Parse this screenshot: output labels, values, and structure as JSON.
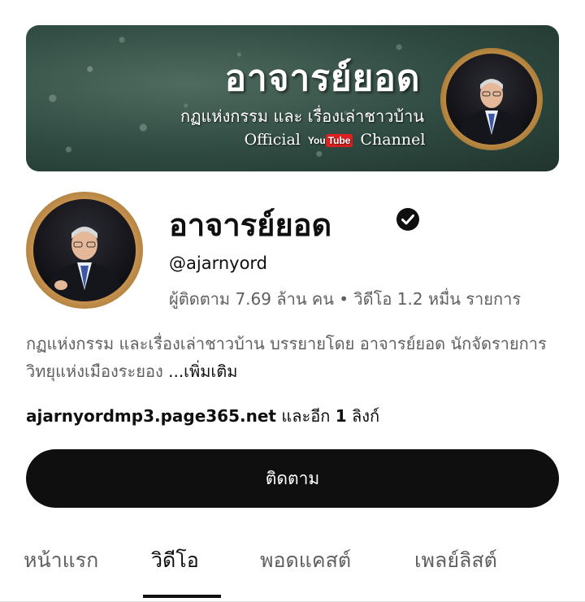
{
  "banner": {
    "title": "อาจารย์ยอด",
    "subtitle": "กฏแห่งกรรม และ เรื่องเล่าชาวบ้าน",
    "channel_prefix": "Official",
    "youtube_you": "You",
    "youtube_tube": "Tube",
    "channel_suffix": "Channel"
  },
  "channel": {
    "name": "อาจารย์ยอด",
    "handle": "@ajarnyord",
    "stats": "ผู้ติดตาม 7.69 ล้าน คน • วิดีโอ 1.2 หมื่น รายการ",
    "verified": true,
    "description_text": "กฏแห่งกรรม และเรื่องเล่าชาวบ้าน บรรยายโดย อาจารย์ยอด นักจัดรายการวิทยุแห่งเมืองระยอง ",
    "description_more": "...เพิ่มเติม",
    "link_url": "ajarnyordmp3.page365.net",
    "link_more_prefix": "และอีก",
    "link_more_count": "1",
    "link_more_suffix": "ลิงก์"
  },
  "subscribe_label": "ติดตาม",
  "tabs": [
    {
      "label": "หน้าแรก"
    },
    {
      "label": "วิดีโอ",
      "active": true
    },
    {
      "label": "พอดแคสต์"
    },
    {
      "label": "เพลย์ลิสต์"
    }
  ],
  "colors": {
    "primary_text": "#0f0f0f",
    "secondary_text": "#606060",
    "button_bg": "#0f0f0f",
    "button_text": "#ffffff"
  },
  "icons": {
    "verified": "verified-check-icon"
  }
}
